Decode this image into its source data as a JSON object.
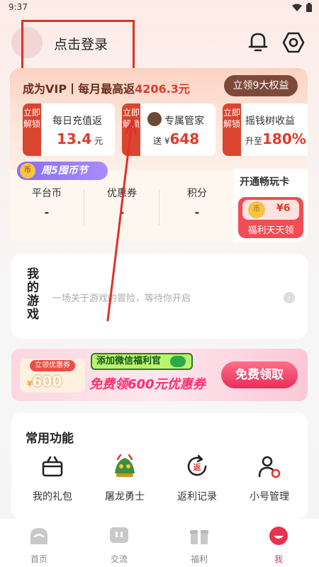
{
  "status": {
    "time": "9:37"
  },
  "header": {
    "login_label": "点击登录"
  },
  "vip": {
    "title_prefix": "成为VIP丨每月最高返",
    "title_amount": "4206.3元",
    "benefits_button": "立领9大权益",
    "perks": [
      {
        "tag": "立即解锁",
        "line1": "每日充值返",
        "value": "13.4",
        "unit": "元"
      },
      {
        "tag": "立即解锁",
        "line1": "专属管家",
        "prefix": "送 ¥",
        "value": "648"
      },
      {
        "tag": "立即解锁",
        "line1": "摇钱树收益",
        "prefix": "升至",
        "value": "180%"
      }
    ]
  },
  "festival": {
    "coin": "币",
    "label": "周5囤币节"
  },
  "stats": [
    {
      "label": "平台币",
      "value": "-"
    },
    {
      "label": "优惠券",
      "value": "-"
    },
    {
      "label": "积分",
      "value": "-"
    }
  ],
  "play_card": {
    "title": "开通畅玩卡",
    "coin": "币",
    "price": "¥6",
    "subtitle": "福利天天领"
  },
  "my_games": {
    "title": "我的游戏",
    "description": "一场关于游戏的冒险，等待你开启"
  },
  "banner": {
    "coupon_top": "立领优惠券",
    "coupon_amount": "600",
    "coupon_currency": "¥",
    "wechat_tag": "添加微信福利官",
    "main_text": "免费领600元优惠券",
    "button": "免费领取"
  },
  "functions": {
    "title": "常用功能",
    "items": [
      {
        "label": "我的礼包",
        "icon": "gift-icon"
      },
      {
        "label": "屠龙勇士",
        "icon": "dragon-icon"
      },
      {
        "label": "返利记录",
        "icon": "rebate-icon"
      },
      {
        "label": "小号管理",
        "icon": "account-manage-icon"
      }
    ]
  },
  "tabs": [
    {
      "label": "首页",
      "icon": "home-icon"
    },
    {
      "label": "交流",
      "icon": "chat-icon"
    },
    {
      "label": "福利",
      "icon": "gift-box-icon"
    },
    {
      "label": "我",
      "icon": "me-icon",
      "active": true
    }
  ],
  "colors": {
    "accent": "#e23a2a",
    "active_tab": "#e23a55",
    "vip_button": "#7d4a3a"
  }
}
